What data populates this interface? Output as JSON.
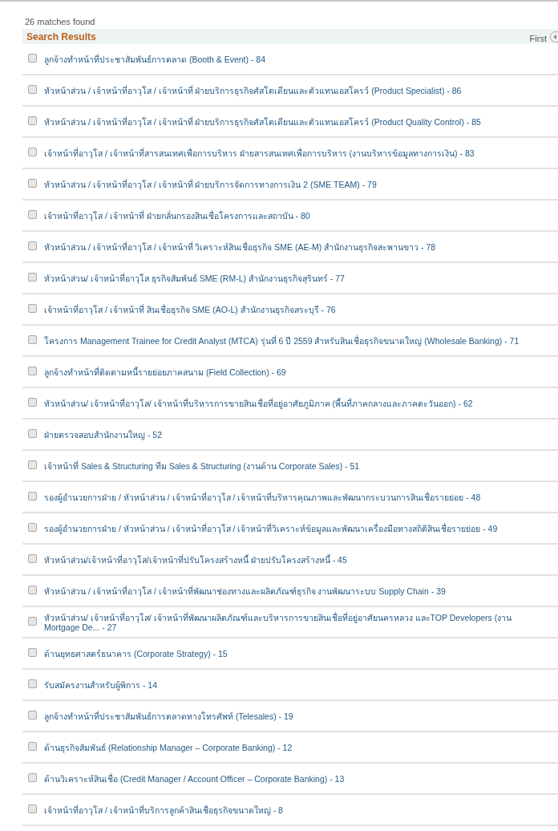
{
  "summary": "26 matches found",
  "results_header": {
    "title": "Search Results",
    "pager_first": "First"
  },
  "results": [
    {
      "label": "ลูกจ้างทำหน้าที่ประชาสัมพันธ์การตลาด (Booth & Event) - 84",
      "checked": false
    },
    {
      "label": "หัวหน้าส่วน / เจ้าหน้าที่อาวุโส / เจ้าหน้าที่ ฝ่ายบริการธุรกิจศัสโตเดียนและตัวแทนเอสโครว์ (Product Specialist) - 86",
      "checked": false
    },
    {
      "label": "หัวหน้าส่วน / เจ้าหน้าที่อาวุโส / เจ้าหน้าที่ ฝ่ายบริการธุรกิจศัสโตเดียนและตัวแทนเอสโครว์ (Product Quality Control) - 85",
      "checked": false
    },
    {
      "label": "เจ้าหน้าที่อาวุโส / เจ้าหน้าที่สารสนเทศเพื่อการบริหาร ฝ่ายสารสนเทศเพื่อการบริหาร (งานบริหารข้อมูลทางการเงิน) - 83",
      "checked": false
    },
    {
      "label": "หัวหน้าส่วน / เจ้าหน้าที่อาวุโส / เจ้าหน้าที่ ฝ่ายบริการจัดการทางการเงิน 2 (SME TEAM) - 79",
      "checked": false
    },
    {
      "label": "เจ้าหน้าที่อาวุโส / เจ้าหน้าที่ ฝ่ายกลั่นกรองสินเชื่อโครงการและสถาบัน - 80",
      "checked": false
    },
    {
      "label": "หัวหน้าส่วน / เจ้าหน้าที่อาวุโส / เจ้าหน้าที่ วิเคราะห์สินเชื่อธุรกิจ SME (AE-M) สำนักงานธุรกิจสะพานขาว - 78",
      "checked": false
    },
    {
      "label": "หัวหน้าส่วน/ เจ้าหน้าที่อาวุโส ธุรกิจสัมพันธ์ SME (RM-L) สำนักงานธุรกิจสุรินทร์ - 77",
      "checked": false
    },
    {
      "label": "เจ้าหน้าที่อาวุโส / เจ้าหน้าที่ สินเชื่อธุรกิจ SME (AO-L) สำนักงานธุรกิจสระบุรี - 76",
      "checked": false
    },
    {
      "label": "โครงการ Management Trainee for Credit Analyst (MTCA) รุ่นที่ 6 ปี 2559 สำหรับสินเชื่อธุรกิจขนาดใหญ่ (Wholesale Banking) - 71",
      "checked": false
    },
    {
      "label": "ลูกจ้างทำหน้าที่ติดตามหนี้รายย่อยภาคสนาม (Field Collection) - 69",
      "checked": false
    },
    {
      "label": "หัวหน้าส่วน/ เจ้าหน้าที่อาวุโส/ เจ้าหน้าที่บริหารการขายสินเชื่อที่อยู่อาศัยภูมิภาค (พื้นที่ภาคกลางและภาคตะวันออก) - 62",
      "checked": false
    },
    {
      "label": "ฝ่ายตรวจสอบสำนักงานใหญ่ - 52",
      "checked": false
    },
    {
      "label": "เจ้าหน้าที่ Sales & Structuring ทีม Sales & Structuring (งานด้าน Corporate Sales) - 51",
      "checked": false
    },
    {
      "label": "รองผู้อำนวยการฝ่าย / หัวหน้าส่วน / เจ้าหน้าที่อาวุโส / เจ้าหน้าที่บริหารคุณภาพและพัฒนากระบวนการสินเชื่อรายย่อย - 48",
      "checked": false
    },
    {
      "label": "รองผู้อำนวยการฝ่าย / หัวหน้าส่วน / เจ้าหน้าที่อาวุโส / เจ้าหน้าที่วิเคราะห์ข้อมูลและพัฒนาเครื่องมือทางสถิติสินเชื่อรายย่อย - 49",
      "checked": false
    },
    {
      "label": "หัวหน้าส่วน/เจ้าหน้าที่อาวุโส/เจ้าหน้าที่ปรับโครงสร้างหนี้ ฝ่ายปรับโครงสร้างหนี้ - 45",
      "checked": false
    },
    {
      "label": "หัวหน้าส่วน / เจ้าหน้าที่อาวุโส / เจ้าหน้าที่พัฒนาช่องทางและผลิตภัณฑ์ธุรกิจ งานพัฒนาระบบ Supply Chain - 39",
      "checked": false
    },
    {
      "label": "หัวหน้าส่วน/ เจ้าหน้าที่อาวุโส/ เจ้าหน้าที่พัฒนาผลิตภัณฑ์และบริหารการขายสินเชื่อที่อยู่อาศัยนครหลวง และTOP Developers (งาน Mortgage De... - 27",
      "checked": false
    },
    {
      "label": "ด้านยุทธศาสตร์ธนาคาร (Corporate Strategy) - 15",
      "checked": false
    },
    {
      "label": "รับสมัครงานสำหรับผู้พิการ - 14",
      "checked": false
    },
    {
      "label": "ลูกจ้างทำหน้าที่ประชาสัมพันธ์การตลาดทางโทรศัพท์ (Telesales) - 19",
      "checked": false
    },
    {
      "label": "ด้านธุรกิจสัมพันธ์ (Relationship Manager – Corporate Banking) - 12",
      "checked": false
    },
    {
      "label": "ด้านวิเคราะห์สินเชื่อ (Credit Manager / Account Officer – Corporate Banking) - 13",
      "checked": false
    },
    {
      "label": "เจ้าหน้าที่อาวุโส / เจ้าหน้าที่บริการลูกค้าสินเชื่อธุรกิจขนาดใหญ่ - 8",
      "checked": false
    }
  ]
}
